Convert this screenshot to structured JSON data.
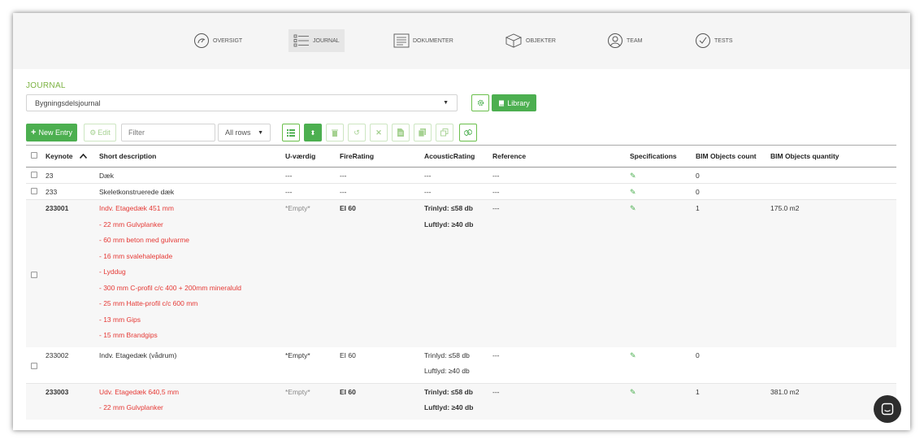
{
  "nav": [
    {
      "label": "OVERSIGT",
      "icon": "gauge-icon"
    },
    {
      "label": "JOURNAL",
      "icon": "list-icon"
    },
    {
      "label": "DOKUMENTER",
      "icon": "document-icon"
    },
    {
      "label": "OBJEKTER",
      "icon": "cube-icon"
    },
    {
      "label": "TEAM",
      "icon": "user-icon"
    },
    {
      "label": "TESTS",
      "icon": "check-circle-icon"
    }
  ],
  "journal": {
    "title": "JOURNAL",
    "selected": "Bygningsdelsjournal",
    "library_label": "Library"
  },
  "toolbar": {
    "new_entry": "New Entry",
    "edit": "Edit",
    "filter_placeholder": "Filter",
    "rows_select": "All rows"
  },
  "colors": {
    "accent": "#4caf50",
    "title_green": "#7cb342",
    "danger": "#e53935"
  },
  "table": {
    "headers": [
      "Keynote",
      "Short description",
      "U-værdig",
      "FireRating",
      "AcousticRating",
      "Reference",
      "Specifications",
      "BIM Objects count",
      "BIM Objects quantity"
    ],
    "rows": [
      {
        "keynote": "23",
        "desc": [
          "Dæk"
        ],
        "u": "---",
        "fire": "---",
        "acoustic": [
          "---"
        ],
        "ref": "---",
        "count": "0",
        "quantity": ""
      },
      {
        "keynote": "233",
        "desc": [
          "Skeletkonstruerede dæk"
        ],
        "u": "---",
        "fire": "---",
        "acoustic": [
          "---"
        ],
        "ref": "---",
        "count": "0",
        "quantity": ""
      },
      {
        "keynote": "233001",
        "desc": [
          "Indv. Etagedæk 451 mm",
          "- 22 mm Gulvplanker",
          "- 60 mm beton med gulvarme",
          "- 16 mm svalehaleplade",
          "- Lyddug",
          "- 300 mm C-profil c/c 400 + 200mm mineraluld",
          "- 25 mm Hatte-profil c/c 600 mm",
          "- 13 mm Gips",
          "- 15 mm Brandgips"
        ],
        "u": "*Empty*",
        "fire": "EI 60",
        "acoustic": [
          "Trinlyd: ≤58 db",
          "Luftlyd: ≥40 db"
        ],
        "ref": "---",
        "count": "1",
        "quantity": "175.0 m2"
      },
      {
        "keynote": "233002",
        "desc": [
          "Indv. Etagedæk (vådrum)"
        ],
        "u": "*Empty*",
        "fire": "EI 60",
        "acoustic": [
          "Trinlyd: ≤58 db",
          "Luftlyd: ≥40 db"
        ],
        "ref": "---",
        "count": "0",
        "quantity": ""
      },
      {
        "keynote": "233003",
        "desc": [
          "Udv. Etagedæk 640,5 mm",
          "- 22 mm Gulvplanker"
        ],
        "u": "*Empty*",
        "fire": "EI 60",
        "acoustic": [
          "Trinlyd: ≤58 db",
          "Luftlyd: ≥40 db"
        ],
        "ref": "---",
        "count": "1",
        "quantity": "381.0 m2"
      }
    ]
  }
}
